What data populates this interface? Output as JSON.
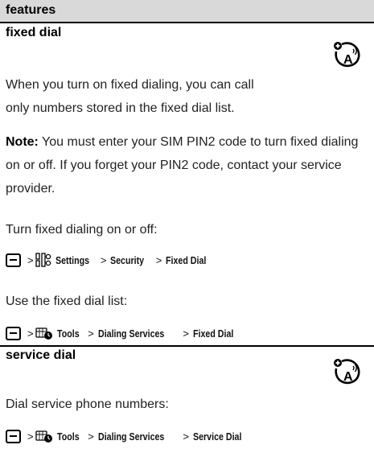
{
  "header": {
    "title": "features"
  },
  "sections": [
    {
      "title": "fixed dial",
      "intro": "When you turn on fixed dialing, you can call only numbers stored in the fixed dial list.",
      "note_label": "Note:",
      "note_text": " You must enter your SIM PIN2 code to turn fixed dialing on or off. If you forget your PIN2 code, contact your service provider.",
      "step1": "Turn fixed dialing on or off:",
      "path1": {
        "sep": ">",
        "items": [
          "Settings",
          "Security",
          "Fixed Dial"
        ]
      },
      "step2": "Use the fixed dial list:",
      "path2": {
        "sep": ">",
        "items": [
          "Tools",
          "Dialing Services",
          "Fixed Dial"
        ]
      }
    },
    {
      "title": "service dial",
      "step1": "Dial service phone numbers:",
      "path1": {
        "sep": ">",
        "items": [
          "Tools",
          "Dialing Services",
          "Service Dial"
        ]
      }
    }
  ],
  "icons": {
    "menu_key": "menu-key-icon",
    "settings": "settings-icon",
    "tools": "tools-icon",
    "network_feature": "network-feature-icon"
  }
}
